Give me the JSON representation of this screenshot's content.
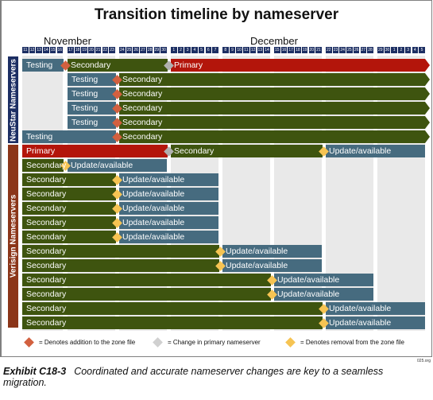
{
  "title": "Transition timeline by nameserver",
  "months": [
    {
      "label": "November",
      "week": 1
    },
    {
      "label": "December",
      "week": 5
    }
  ],
  "weeks": [
    [
      "11",
      "12",
      "13",
      "14",
      "15",
      "16"
    ],
    [
      "17",
      "18",
      "19",
      "20",
      "21",
      "22",
      "23"
    ],
    [
      "24",
      "25",
      "26",
      "27",
      "28",
      "29",
      "30"
    ],
    [
      "1",
      "2",
      "3",
      "4",
      "5",
      "6",
      "7"
    ],
    [
      "8",
      "9",
      "10",
      "11",
      "12",
      "13",
      "14"
    ],
    [
      "15",
      "16",
      "17",
      "18",
      "19",
      "20",
      "21"
    ],
    [
      "22",
      "23",
      "24",
      "25",
      "26",
      "27",
      "28"
    ],
    [
      "29",
      "30",
      "1",
      "2",
      "3",
      "4",
      "5"
    ]
  ],
  "groups": [
    {
      "id": "neustar",
      "label": "NeuStar Nameservers",
      "color": "#1c2e63"
    },
    {
      "id": "verisign",
      "label": "Verisign Nameservers",
      "color": "#8b3519"
    }
  ],
  "colors": {
    "testing": "#466b7f",
    "secondary": "#3e540f",
    "primary": "#b3150b",
    "update": "#466b7f",
    "addition": "#d2603f",
    "change": "#b0b0b0",
    "removal": "#f6c453"
  },
  "rows": [
    {
      "group": "neustar",
      "arrow": true,
      "segments": [
        {
          "label": "Testing",
          "status": "testing",
          "start": "Nov 11",
          "end": "Nov 16"
        },
        {
          "label": "Secondary",
          "status": "secondary",
          "start": "Nov 17",
          "end": "Nov 30"
        },
        {
          "label": "Primary",
          "status": "primary",
          "start": "Dec 1",
          "end": "Jan 5"
        }
      ],
      "markers": [
        {
          "type": "addition",
          "after": "Nov 16"
        },
        {
          "type": "change",
          "after": "Nov 30"
        }
      ]
    },
    {
      "group": "neustar",
      "arrow": true,
      "segments": [
        {
          "label": "Testing",
          "status": "testing",
          "start": "Nov 17",
          "end": "Nov 23"
        },
        {
          "label": "Secondary",
          "status": "secondary",
          "start": "Nov 24",
          "end": "Jan 5"
        }
      ],
      "markers": [
        {
          "type": "addition",
          "after": "Nov 23"
        }
      ]
    },
    {
      "group": "neustar",
      "arrow": true,
      "segments": [
        {
          "label": "Testing",
          "status": "testing",
          "start": "Nov 17",
          "end": "Nov 23"
        },
        {
          "label": "Secondary",
          "status": "secondary",
          "start": "Nov 24",
          "end": "Jan 5"
        }
      ],
      "markers": [
        {
          "type": "addition",
          "after": "Nov 23"
        }
      ]
    },
    {
      "group": "neustar",
      "arrow": true,
      "segments": [
        {
          "label": "Testing",
          "status": "testing",
          "start": "Nov 17",
          "end": "Nov 23"
        },
        {
          "label": "Secondary",
          "status": "secondary",
          "start": "Nov 24",
          "end": "Jan 5"
        }
      ],
      "markers": [
        {
          "type": "addition",
          "after": "Nov 23"
        }
      ]
    },
    {
      "group": "neustar",
      "arrow": true,
      "segments": [
        {
          "label": "Testing",
          "status": "testing",
          "start": "Nov 17",
          "end": "Nov 23"
        },
        {
          "label": "Secondary",
          "status": "secondary",
          "start": "Nov 24",
          "end": "Jan 5"
        }
      ],
      "markers": [
        {
          "type": "addition",
          "after": "Nov 23"
        }
      ]
    },
    {
      "group": "neustar",
      "arrow": true,
      "segments": [
        {
          "label": "Testing",
          "status": "testing",
          "start": "Nov 11",
          "end": "Nov 23"
        },
        {
          "label": "Secondary",
          "status": "secondary",
          "start": "Nov 24",
          "end": "Jan 5"
        }
      ],
      "markers": [
        {
          "type": "addition",
          "after": "Nov 23"
        }
      ]
    },
    {
      "group": "verisign",
      "arrow": false,
      "segments": [
        {
          "label": "Primary",
          "status": "primary",
          "start": "Nov 11",
          "end": "Nov 30"
        },
        {
          "label": "Secondary",
          "status": "secondary",
          "start": "Dec 1",
          "end": "Dec 21"
        },
        {
          "label": "Update/available",
          "status": "update",
          "start": "Dec 22",
          "end": "Jan 5"
        }
      ],
      "markers": [
        {
          "type": "change",
          "after": "Nov 30"
        },
        {
          "type": "removal",
          "after": "Dec 21"
        }
      ]
    },
    {
      "group": "verisign",
      "arrow": false,
      "segments": [
        {
          "label": "Secondary",
          "status": "secondary",
          "start": "Nov 11",
          "end": "Nov 16"
        },
        {
          "label": "Update/available",
          "status": "update",
          "start": "Nov 17",
          "end": "Nov 30"
        }
      ],
      "markers": [
        {
          "type": "removal",
          "after": "Nov 16"
        }
      ]
    },
    {
      "group": "verisign",
      "arrow": false,
      "segments": [
        {
          "label": "Secondary",
          "status": "secondary",
          "start": "Nov 11",
          "end": "Nov 23"
        },
        {
          "label": "Update/available",
          "status": "update",
          "start": "Nov 24",
          "end": "Dec 7"
        }
      ],
      "markers": [
        {
          "type": "removal",
          "after": "Nov 23"
        }
      ]
    },
    {
      "group": "verisign",
      "arrow": false,
      "segments": [
        {
          "label": "Secondary",
          "status": "secondary",
          "start": "Nov 11",
          "end": "Nov 23"
        },
        {
          "label": "Update/available",
          "status": "update",
          "start": "Nov 24",
          "end": "Dec 7"
        }
      ],
      "markers": [
        {
          "type": "removal",
          "after": "Nov 23"
        }
      ]
    },
    {
      "group": "verisign",
      "arrow": false,
      "segments": [
        {
          "label": "Secondary",
          "status": "secondary",
          "start": "Nov 11",
          "end": "Nov 23"
        },
        {
          "label": "Update/available",
          "status": "update",
          "start": "Nov 24",
          "end": "Dec 7"
        }
      ],
      "markers": [
        {
          "type": "removal",
          "after": "Nov 23"
        }
      ]
    },
    {
      "group": "verisign",
      "arrow": false,
      "segments": [
        {
          "label": "Secondary",
          "status": "secondary",
          "start": "Nov 11",
          "end": "Nov 23"
        },
        {
          "label": "Update/available",
          "status": "update",
          "start": "Nov 24",
          "end": "Dec 7"
        }
      ],
      "markers": [
        {
          "type": "removal",
          "after": "Nov 23"
        }
      ]
    },
    {
      "group": "verisign",
      "arrow": false,
      "segments": [
        {
          "label": "Secondary",
          "status": "secondary",
          "start": "Nov 11",
          "end": "Nov 23"
        },
        {
          "label": "Update/available",
          "status": "update",
          "start": "Nov 24",
          "end": "Dec 7"
        }
      ],
      "markers": [
        {
          "type": "removal",
          "after": "Nov 23"
        }
      ]
    },
    {
      "group": "verisign",
      "arrow": false,
      "segments": [
        {
          "label": "Secondary",
          "status": "secondary",
          "start": "Nov 11",
          "end": "Dec 7"
        },
        {
          "label": "Update/available",
          "status": "update",
          "start": "Dec 8",
          "end": "Dec 21"
        }
      ],
      "markers": [
        {
          "type": "removal",
          "after": "Dec 7"
        }
      ]
    },
    {
      "group": "verisign",
      "arrow": false,
      "segments": [
        {
          "label": "Secondary",
          "status": "secondary",
          "start": "Nov 11",
          "end": "Dec 7"
        },
        {
          "label": "Update/available",
          "status": "update",
          "start": "Dec 8",
          "end": "Dec 21"
        }
      ],
      "markers": [
        {
          "type": "removal",
          "after": "Dec 7"
        }
      ]
    },
    {
      "group": "verisign",
      "arrow": false,
      "segments": [
        {
          "label": "Secondary",
          "status": "secondary",
          "start": "Nov 11",
          "end": "Dec 14"
        },
        {
          "label": "Update/available",
          "status": "update",
          "start": "Dec 15",
          "end": "Dec 28"
        }
      ],
      "markers": [
        {
          "type": "removal",
          "after": "Dec 14"
        }
      ]
    },
    {
      "group": "verisign",
      "arrow": false,
      "segments": [
        {
          "label": "Secondary",
          "status": "secondary",
          "start": "Nov 11",
          "end": "Dec 14"
        },
        {
          "label": "Update/available",
          "status": "update",
          "start": "Dec 15",
          "end": "Dec 28"
        }
      ],
      "markers": [
        {
          "type": "removal",
          "after": "Dec 14"
        }
      ]
    },
    {
      "group": "verisign",
      "arrow": false,
      "segments": [
        {
          "label": "Secondary",
          "status": "secondary",
          "start": "Nov 11",
          "end": "Dec 21"
        },
        {
          "label": "Update/available",
          "status": "update",
          "start": "Dec 22",
          "end": "Jan 5"
        }
      ],
      "markers": [
        {
          "type": "removal",
          "after": "Dec 21"
        }
      ]
    },
    {
      "group": "verisign",
      "arrow": false,
      "segments": [
        {
          "label": "Secondary",
          "status": "secondary",
          "start": "Nov 11",
          "end": "Dec 21"
        },
        {
          "label": "Update/available",
          "status": "update",
          "start": "Dec 22",
          "end": "Jan 5"
        }
      ],
      "markers": [
        {
          "type": "removal",
          "after": "Dec 21"
        }
      ]
    }
  ],
  "legend": [
    {
      "type": "addition",
      "label": "= Denotes addition to the zone file"
    },
    {
      "type": "change",
      "label": "= Change in primary nameserver"
    },
    {
      "type": "removal",
      "label": "= Denotes removal from the zone file"
    }
  ],
  "source": "025.org",
  "caption": {
    "exhibit": "Exhibit C18-3",
    "text": "Coordinated and accurate nameserver changes are key to a seamless migration."
  }
}
